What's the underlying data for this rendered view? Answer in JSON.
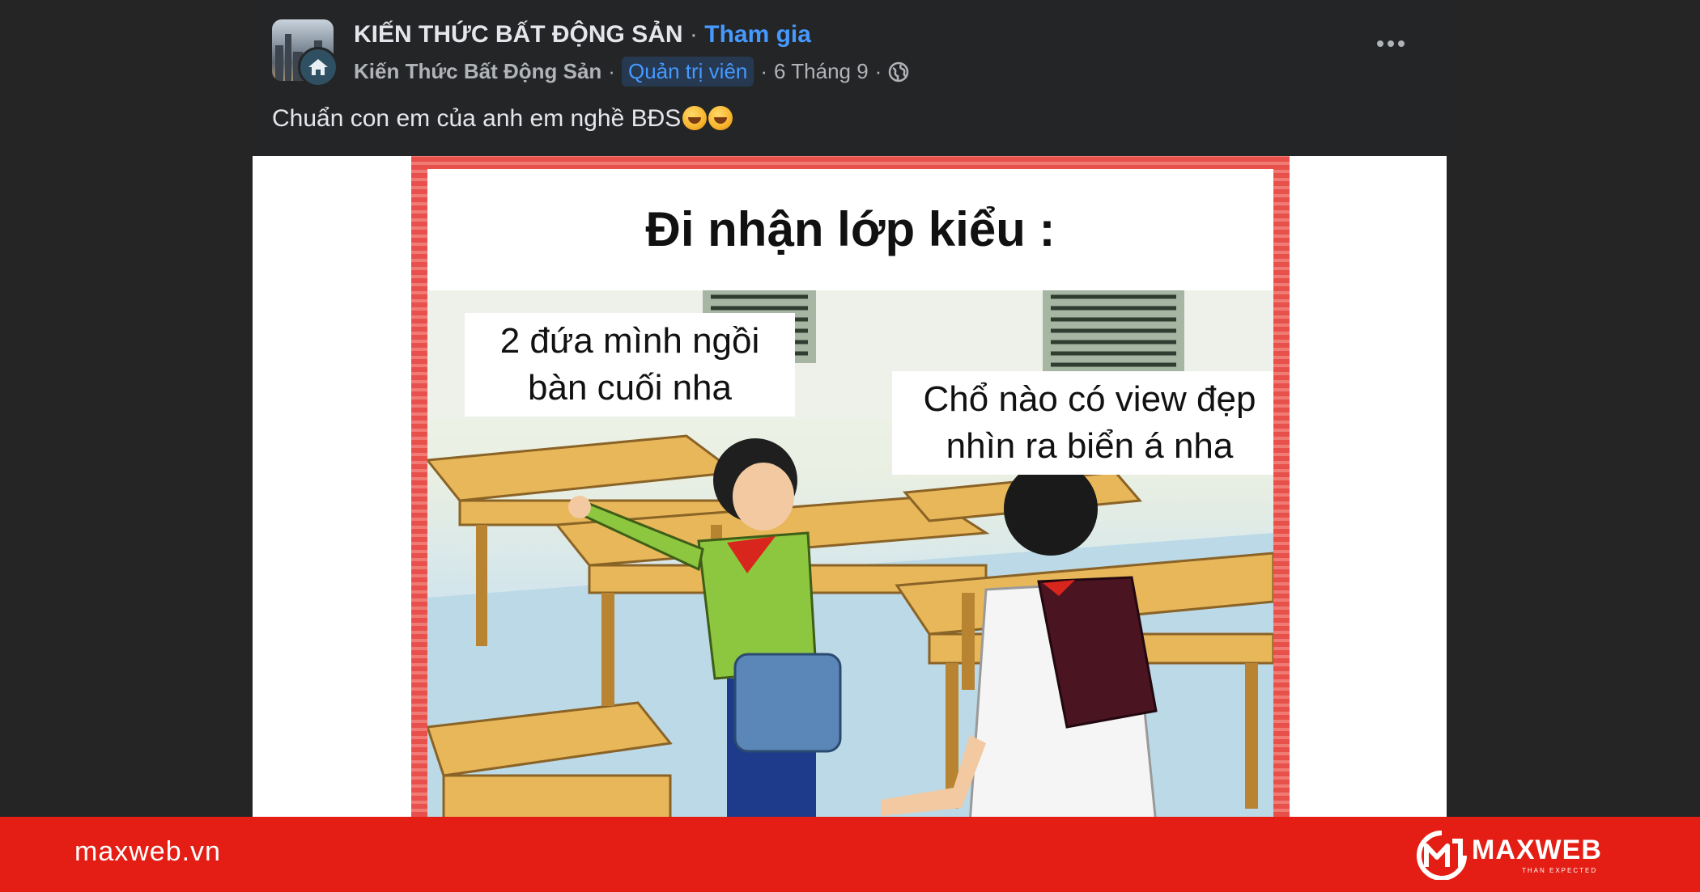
{
  "post": {
    "group_name": "KIẾN THỨC BẤT ĐỘNG SẢN",
    "separator": "·",
    "join_label": "Tham gia",
    "author": "Kiến Thức Bất Động Sản",
    "role_badge": "Quản trị viên",
    "date": "6 Tháng 9",
    "privacy_icon": "globe-icon",
    "more_icon": "more-options-icon",
    "text": "Chuẩn con em của anh em nghề BĐS",
    "emojis": [
      "rolling-laughing-emoji",
      "rolling-laughing-emoji"
    ]
  },
  "image": {
    "title": "Đi nhận lớp kiểu :",
    "bubble_left_line1": "2 đứa mình ngồi",
    "bubble_left_line2": "bàn cuối nha",
    "bubble_right_line1": "Chổ nào có view đẹp",
    "bubble_right_line2": "nhìn ra biển á nha"
  },
  "footer": {
    "website": "maxweb.vn",
    "brand": "MAXWEB",
    "tagline": "THAN EXPECTED"
  },
  "colors": {
    "footer_bg": "#e41e14",
    "link_blue": "#4599ff",
    "post_bg": "#242526",
    "page_bg": "#252525"
  }
}
